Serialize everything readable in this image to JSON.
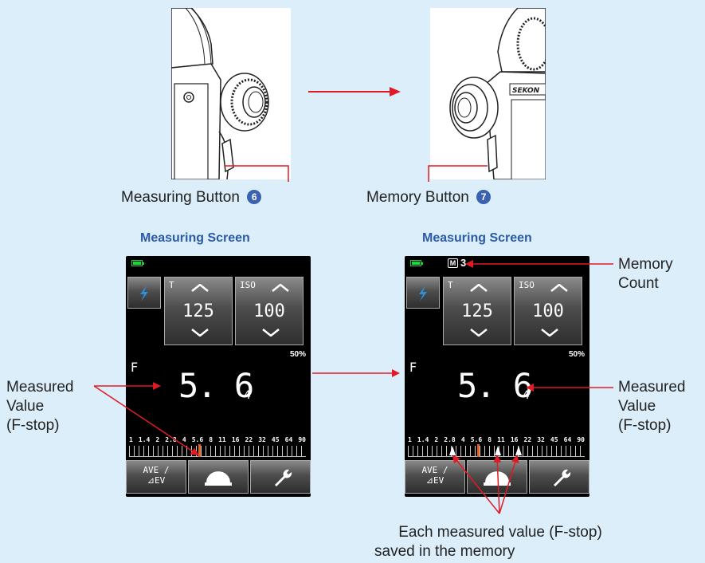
{
  "left_panel": {
    "button_caption": "Measuring Button",
    "button_number": "6",
    "screen_title": "Measuring Screen"
  },
  "right_panel": {
    "button_caption": "Memory Button",
    "button_number": "7",
    "screen_title": "Measuring Screen"
  },
  "screen": {
    "t_label": "T",
    "t_value": "125",
    "iso_label": "ISO",
    "iso_value": "100",
    "percent": "50%",
    "f_label": "F",
    "f_value": "5. 6",
    "f_sub": "4",
    "scale": [
      "1",
      "1.4",
      "2",
      "2.8",
      "4",
      "5.6",
      "8",
      "11",
      "16",
      "22",
      "32",
      "45",
      "64",
      "90"
    ],
    "ave_label": "AVE /\n⊿EV",
    "memory_badge": "M",
    "memory_count": "3"
  },
  "annotations": {
    "measured_value_left": [
      "Measured",
      "Value",
      "(F-stop)"
    ],
    "measured_value_right": [
      "Measured",
      "Value",
      "(F-stop)"
    ],
    "memory_count": [
      "Memory",
      "Count"
    ],
    "each_measured": [
      "Each measured value (F-stop)",
      "saved in the memory"
    ]
  },
  "colors": {
    "background": "#dbeefa",
    "arrow": "#e01b24",
    "title_blue": "#2a5aa8",
    "badge_blue": "#3a62b0",
    "battery_green": "#1fd43a"
  }
}
